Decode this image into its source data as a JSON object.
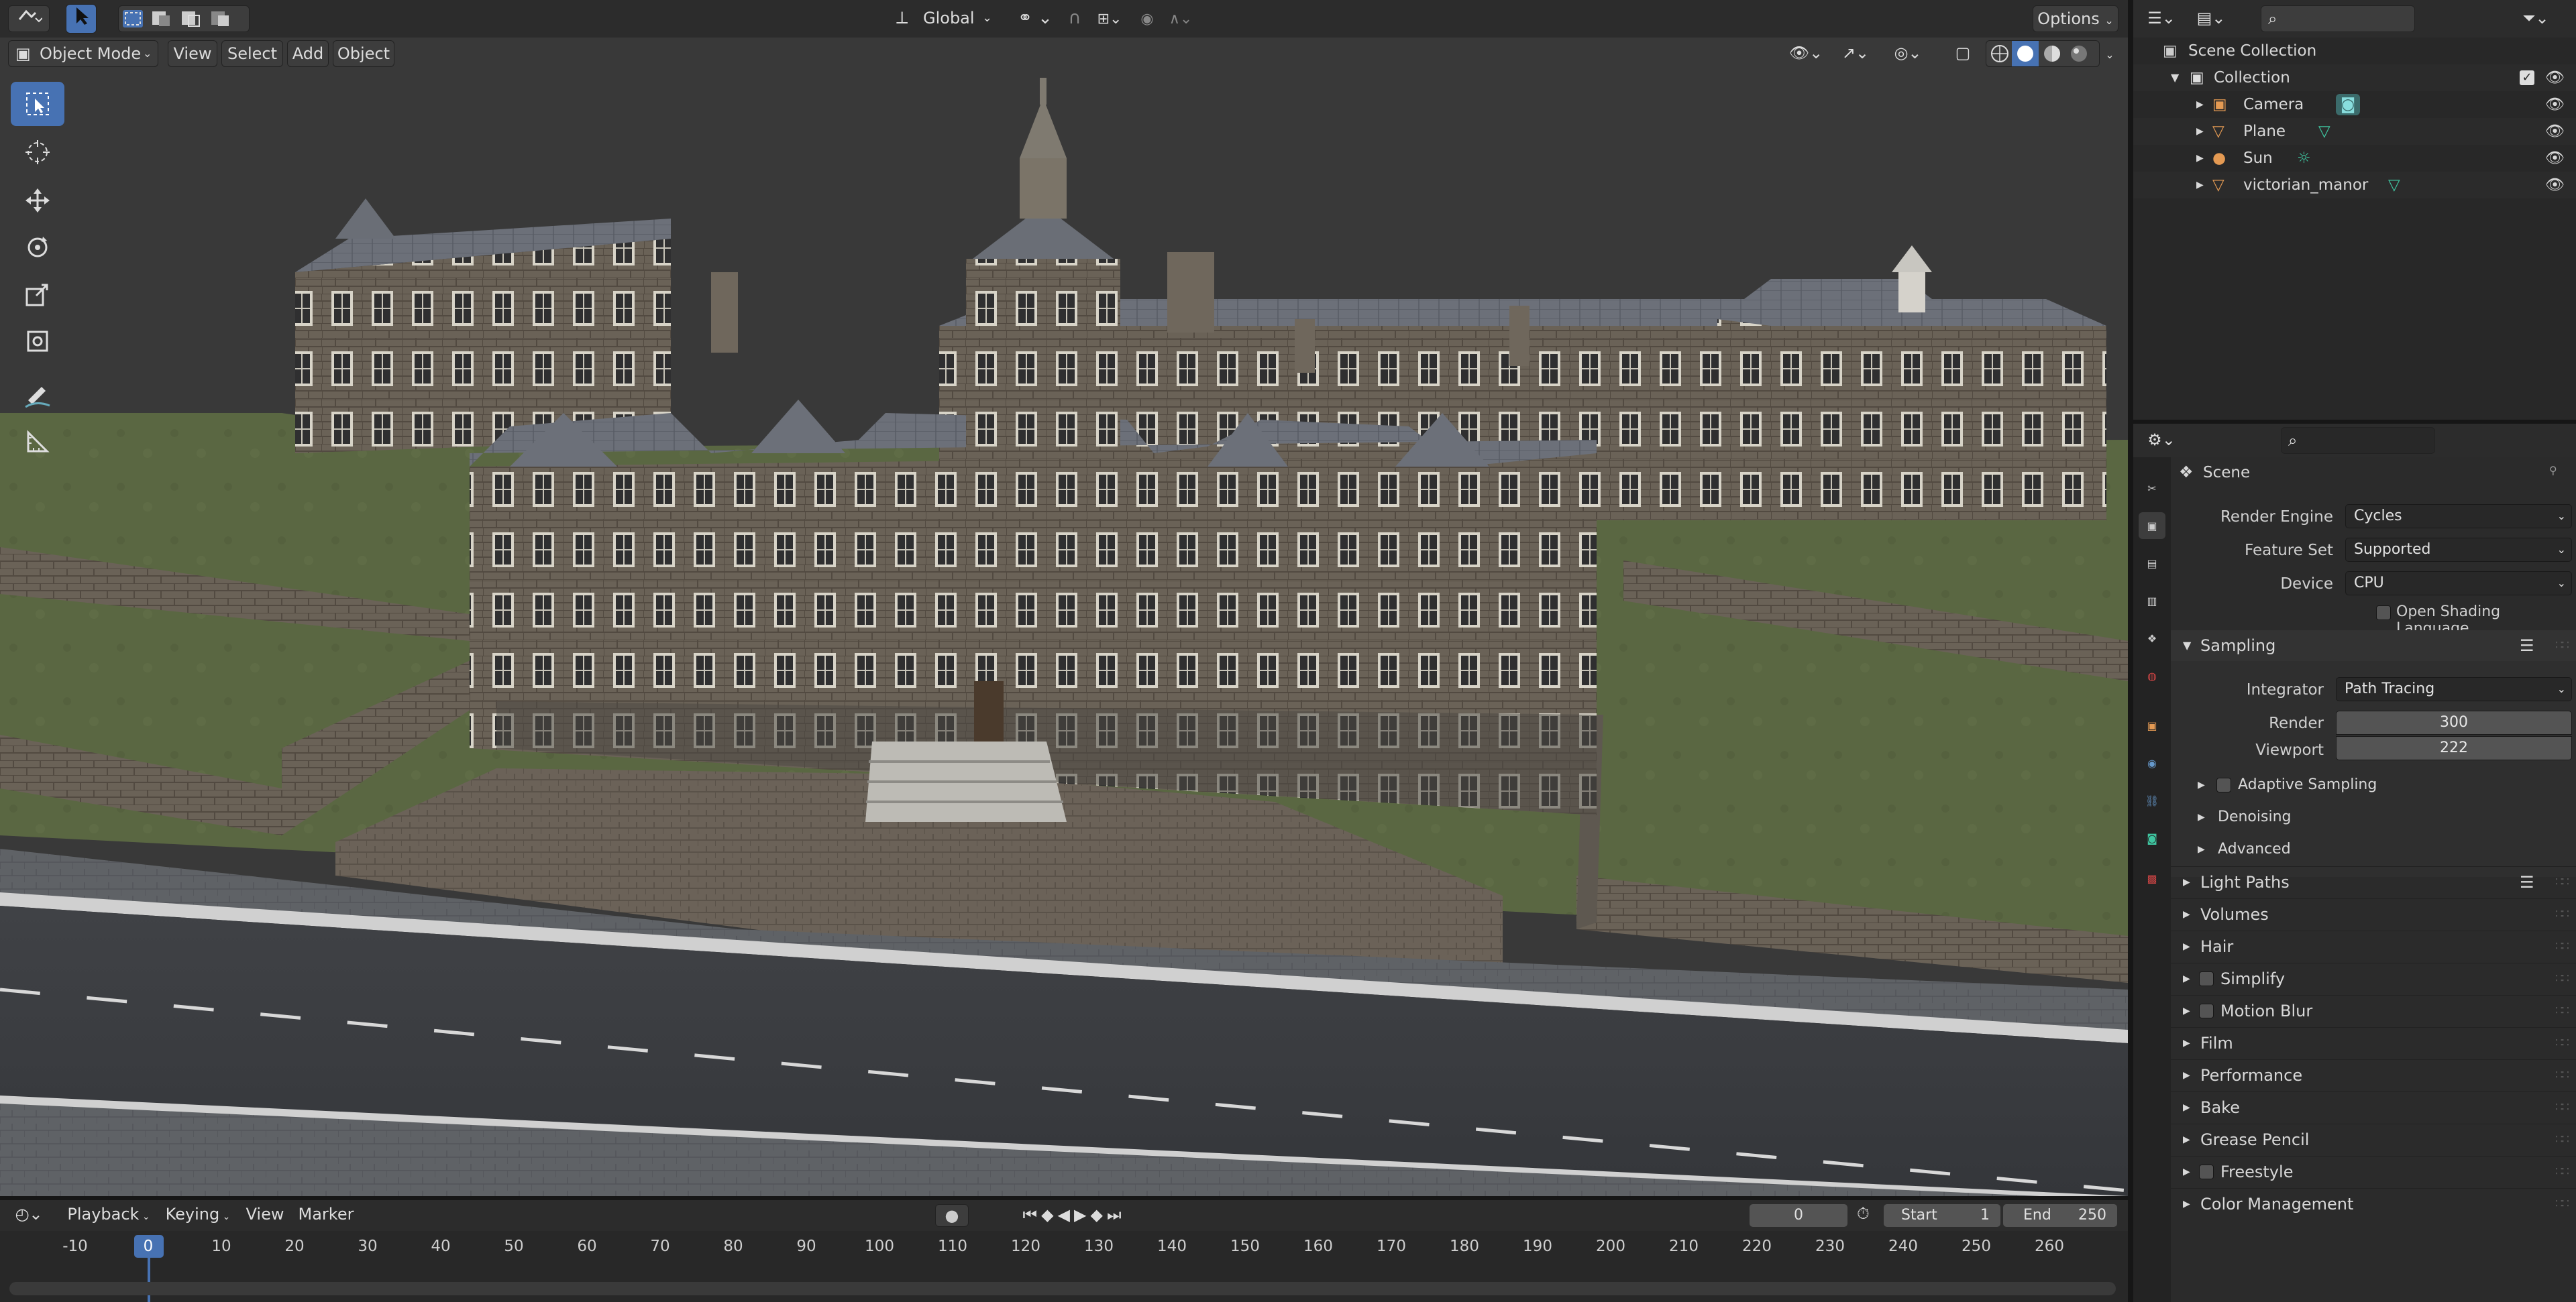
{
  "viewport_header": {
    "orientation": "Global",
    "options_label": "Options",
    "mode": "Object Mode",
    "menus": [
      "View",
      "Select",
      "Add",
      "Object"
    ]
  },
  "outliner": {
    "root": "Scene Collection",
    "collection": "Collection",
    "items": [
      {
        "label": "Camera",
        "icon": "camera-icon",
        "data_icon": "camera-data-icon"
      },
      {
        "label": "Plane",
        "icon": "mesh-icon",
        "data_icon": "mesh-data-icon"
      },
      {
        "label": "Sun",
        "icon": "light-icon",
        "data_icon": "sun-data-icon"
      },
      {
        "label": "victorian_manor",
        "icon": "mesh-icon",
        "data_icon": "mesh-data-icon"
      }
    ]
  },
  "properties": {
    "context": "Scene",
    "render_engine_label": "Render Engine",
    "render_engine": "Cycles",
    "feature_set_label": "Feature Set",
    "feature_set": "Supported",
    "device_label": "Device",
    "device": "CPU",
    "osl_label": "Open Shading Language",
    "sampling": {
      "title": "Sampling",
      "integrator_label": "Integrator",
      "integrator": "Path Tracing",
      "render_label": "Render",
      "render": "300",
      "viewport_label": "Viewport",
      "viewport": "222",
      "subpanels": [
        "Adaptive Sampling",
        "Denoising",
        "Advanced"
      ]
    },
    "panels": [
      "Light Paths",
      "Volumes",
      "Hair",
      "Simplify",
      "Motion Blur",
      "Film",
      "Performance",
      "Bake",
      "Grease Pencil",
      "Freestyle",
      "Color Management"
    ]
  },
  "timeline": {
    "menus": [
      "Playback",
      "Keying",
      "View",
      "Marker"
    ],
    "current_frame": "0",
    "start_label": "Start",
    "start": "1",
    "end_label": "End",
    "end": "250",
    "ticks": [
      "-10",
      "0",
      "10",
      "20",
      "30",
      "40",
      "50",
      "60",
      "70",
      "80",
      "90",
      "100",
      "110",
      "120",
      "130",
      "140",
      "150",
      "160",
      "170",
      "180",
      "190",
      "200",
      "210",
      "220",
      "230",
      "240",
      "250",
      "260"
    ]
  },
  "colors": {
    "accent": "#4772b3",
    "panel_bg": "#2b2b2b",
    "header_bg": "#2c2c2c"
  }
}
